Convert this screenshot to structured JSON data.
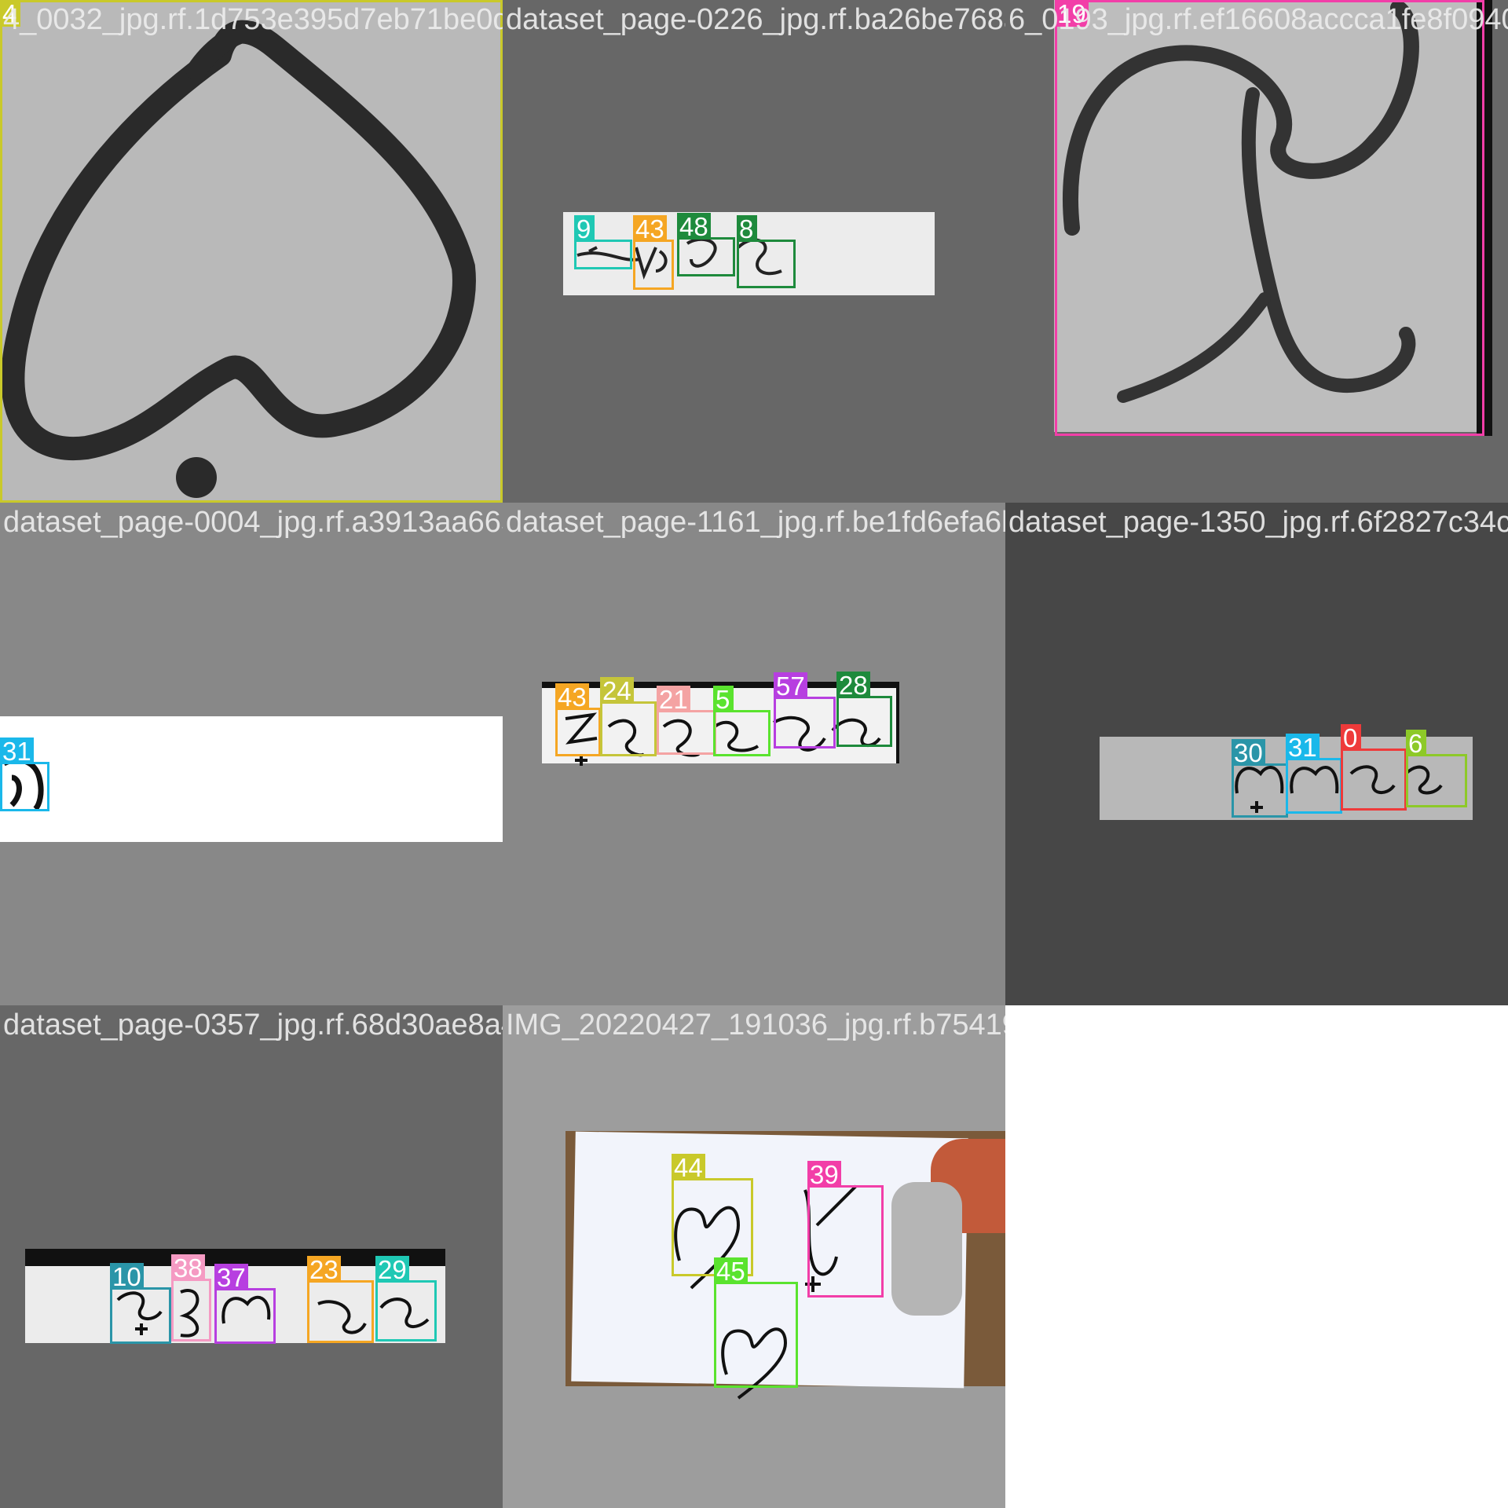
{
  "mosaic": {
    "tiles": [
      {
        "filename": "4_0032_jpg.rf.1d753e395d7eb71be0dd201d75",
        "detections": [
          {
            "label": "4",
            "color": "#c9c92a"
          }
        ]
      },
      {
        "filename": "dataset_page-0226_jpg.rf.ba26be768a6f8",
        "detections": [
          {
            "label": "9",
            "color": "#1fc8b4"
          },
          {
            "label": "43",
            "color": "#f5a623"
          },
          {
            "label": "48",
            "color": "#1e8a3c"
          },
          {
            "label": "8",
            "color": "#1e8a3c"
          }
        ]
      },
      {
        "filename": "6_0193_jpg.rf.ef16608accca1fe8f0940",
        "detections": [
          {
            "label": "19",
            "color": "#f23ea8"
          }
        ]
      },
      {
        "filename": "dataset_page-0004_jpg.rf.a3913aa66573fsd",
        "detections": [
          {
            "label": "31",
            "color": "#1ab8ea"
          }
        ]
      },
      {
        "filename": "dataset_page-1161_jpg.rf.be1fd6efa6bcab6",
        "detections": [
          {
            "label": "43",
            "color": "#f5a623"
          },
          {
            "label": "24",
            "color": "#c5c53a"
          },
          {
            "label": "21",
            "color": "#f4a3a3"
          },
          {
            "label": "5",
            "color": "#5ae32e"
          },
          {
            "label": "57",
            "color": "#b73fe0"
          },
          {
            "label": "28",
            "color": "#1e8a3c"
          }
        ]
      },
      {
        "filename": "dataset_page-1350_jpg.rf.6f2827c34c",
        "detections": [
          {
            "label": "30",
            "color": "#2a95a8"
          },
          {
            "label": "31",
            "color": "#1ab8ea"
          },
          {
            "label": "0",
            "color": "#ee3a3a"
          },
          {
            "label": "6",
            "color": "#8dc928"
          }
        ]
      },
      {
        "filename": "dataset_page-0357_jpg.rf.68d30ae8a4b51e",
        "detections": [
          {
            "label": "10",
            "color": "#2a95a8"
          },
          {
            "label": "38",
            "color": "#f59ac3"
          },
          {
            "label": "37",
            "color": "#b73fe0"
          },
          {
            "label": "23",
            "color": "#f5a623"
          },
          {
            "label": "29",
            "color": "#1fc8b4"
          }
        ]
      },
      {
        "filename": "IMG_20220427_191036_jpg.rf.b754193d916d2",
        "detections": [
          {
            "label": "44",
            "color": "#c9c92a"
          },
          {
            "label": "39",
            "color": "#f23ea8"
          },
          {
            "label": "45",
            "color": "#5ae32e"
          }
        ]
      }
    ]
  }
}
